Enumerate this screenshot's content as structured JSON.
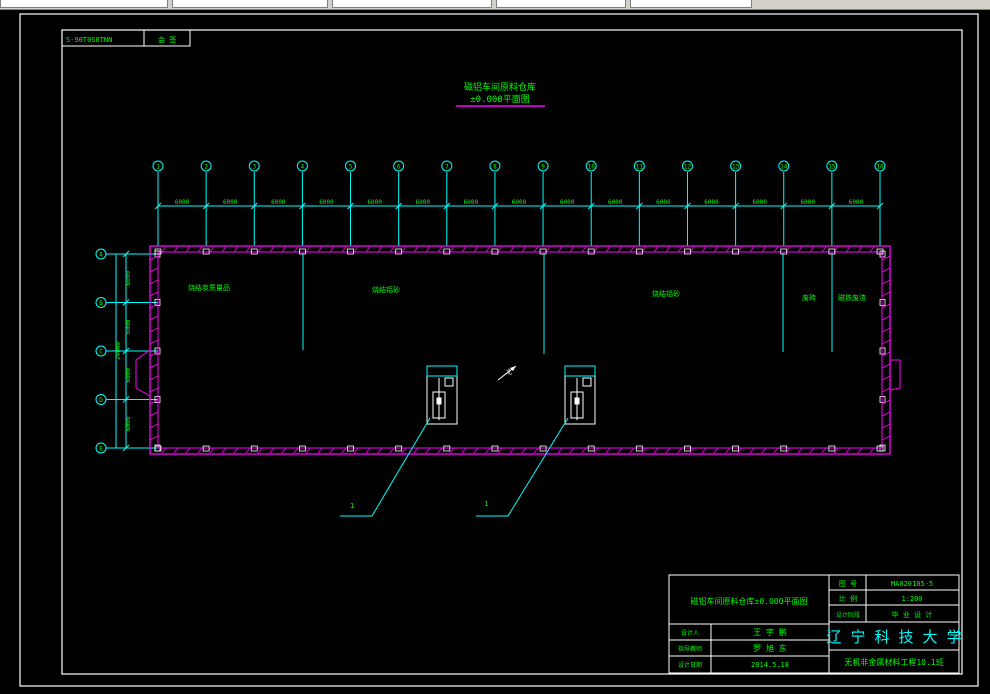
{
  "drawing": {
    "title_line1": "磁铝车间原料仓库",
    "title_line2": "±0.000平面图",
    "stamp_code": "S-90T0S0TNN",
    "stamp_label": "会 签",
    "axis_numbers": [
      "1",
      "2",
      "3",
      "4",
      "5",
      "6",
      "7",
      "8",
      "9",
      "10",
      "11",
      "12",
      "13",
      "14",
      "15",
      "16"
    ],
    "bay_dims": [
      "6000",
      "6000",
      "6000",
      "6000",
      "6000",
      "6000",
      "6000",
      "6000",
      "6000",
      "6000",
      "6000",
      "6000",
      "6000",
      "6000",
      "6000"
    ],
    "axis_letters": [
      "A",
      "B",
      "C",
      "D",
      "E"
    ],
    "side_dims": [
      "6000",
      "6000",
      "6000",
      "6000"
    ],
    "side_total": "24000",
    "rooms": [
      "烧结炭质量品",
      "烧结铝砂",
      "烧结铝砂",
      "废砖",
      "磁铁废渣"
    ],
    "leaders": [
      "1",
      "1"
    ],
    "north_label": "北"
  },
  "title_block": {
    "drawing_name": "磁铝车间原料仓库±0.000平面图",
    "k_drawing_no": "图 号",
    "v_drawing_no": "MA020105-5",
    "k_scale": "比 例",
    "v_scale": "1:200",
    "k_stage": "设计阶段",
    "v_stage": "毕 业 设 计",
    "k_designer": "设计人",
    "v_designer": "王 宇 鹏",
    "k_advisor": "指导教师",
    "v_advisor": "罗 旭 东",
    "k_date": "设计日期",
    "v_date": "2014.5.18",
    "university": "辽 宁 科 技 大 学",
    "class_name": "无机非金属材料工程10.1班"
  },
  "colors": {
    "background": "#000000",
    "frame": "#ffffff",
    "wall": "#ff00ff",
    "dimension": "#00ffff",
    "text": "#00ff00",
    "title_underline": "#ff00ff"
  }
}
